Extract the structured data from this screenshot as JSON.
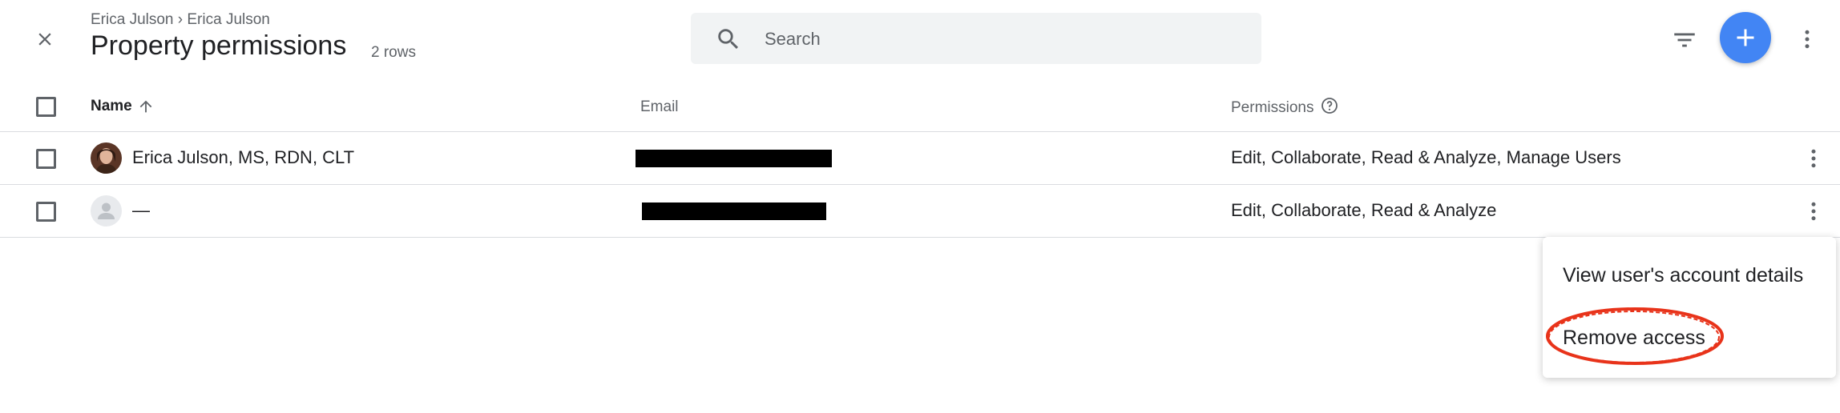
{
  "header": {
    "breadcrumb": "Erica Julson › Erica Julson",
    "title": "Property permissions",
    "row_count": "2 rows"
  },
  "search": {
    "placeholder": "Search",
    "value": ""
  },
  "colors": {
    "accent": "#4285f4",
    "highlight": "#e8331a"
  },
  "table": {
    "columns": {
      "name": "Name",
      "email": "Email",
      "permissions": "Permissions"
    },
    "sort": {
      "column": "name",
      "direction": "ascending"
    },
    "rows": [
      {
        "name": "Erica Julson, MS, RDN, CLT",
        "email_redacted": true,
        "permissions": "Edit, Collaborate, Read & Analyze, Manage Users",
        "avatar": "photo"
      },
      {
        "name": "—",
        "email_redacted": true,
        "permissions": "Edit, Collaborate, Read & Analyze",
        "avatar": "default-person"
      }
    ]
  },
  "row_menu": {
    "items": [
      "View user's account details",
      "Remove access"
    ],
    "highlighted_item": "Remove access"
  },
  "icons": [
    "close-icon",
    "search-icon",
    "filter-icon",
    "add-icon",
    "more-vert-icon",
    "arrow-up-icon",
    "help-circle-icon",
    "person-icon"
  ]
}
